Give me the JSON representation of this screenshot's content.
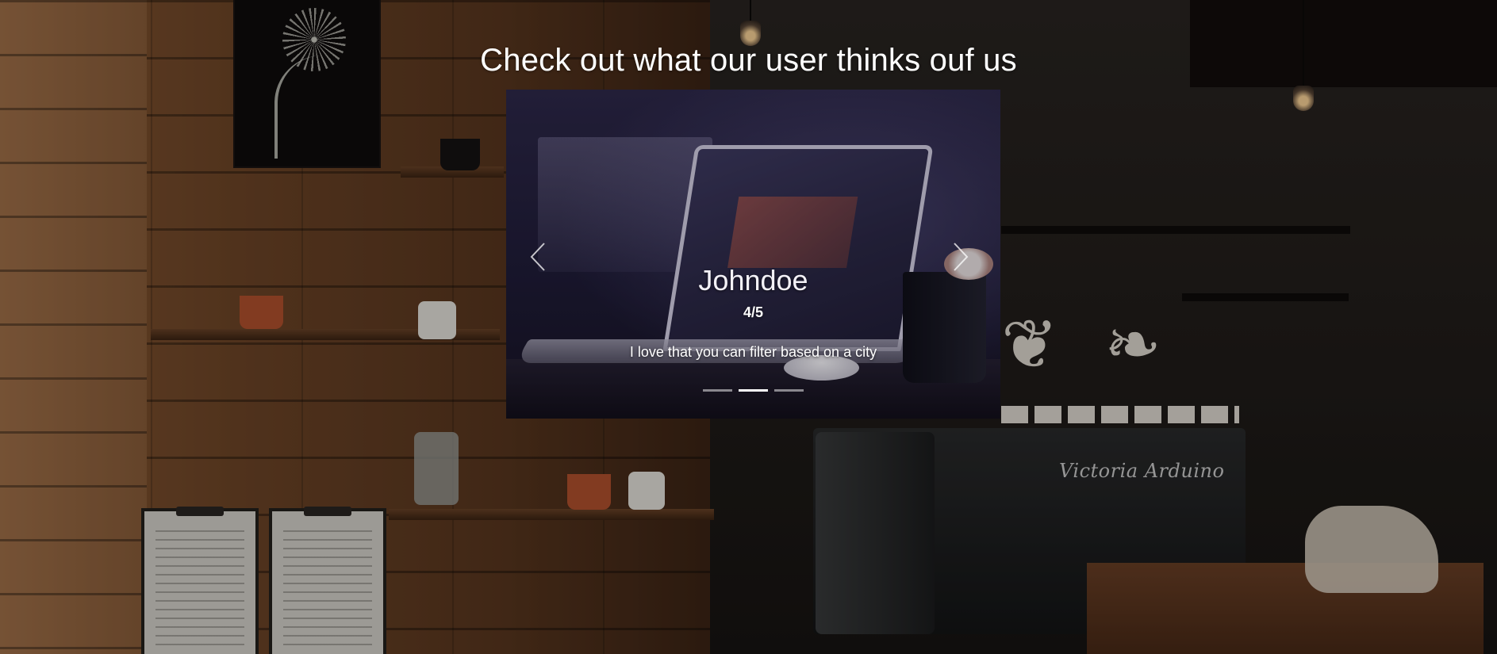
{
  "section": {
    "title": "Check out what our user thinks ouf us"
  },
  "carousel": {
    "active_index": 1,
    "slides_count": 3,
    "current_slide": {
      "name": "Johndoe",
      "rating": "4/5",
      "review": "I love that you can filter based on a city"
    },
    "controls": {
      "prev_icon": "chevron-left-icon",
      "next_icon": "chevron-right-icon"
    }
  },
  "background": {
    "sign_text": "Victoria Arduino"
  },
  "colors": {
    "title_text": "#ffffff",
    "indicator_active": "#ffffff",
    "indicator_inactive": "rgba(255,255,255,0.5)"
  }
}
